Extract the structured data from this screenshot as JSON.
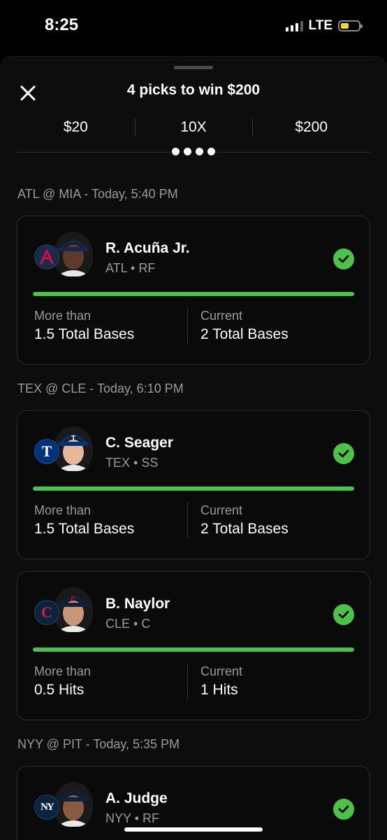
{
  "status_bar": {
    "time": "8:25",
    "network": "LTE"
  },
  "sheet": {
    "title": "4 picks to win $200",
    "summary": {
      "entry": "$20",
      "multiplier": "10X",
      "payout": "$200"
    }
  },
  "picks": [
    {
      "game_label": "ATL @ MIA - Today, 5:40 PM",
      "team_logo_letter": "A",
      "team_color": "#13274F",
      "accent_color": "#CE1141",
      "player_name": "R. Acuña Jr.",
      "team": "ATL",
      "position": "RF",
      "stat_label": "More than",
      "stat_line": "1.5 Total Bases",
      "current_label": "Current",
      "current_value": "2 Total Bases",
      "progress": 1.0,
      "status_icon": "check-icon"
    },
    {
      "game_label": "TEX @ CLE - Today, 6:10 PM",
      "team_logo_letter": "T",
      "team_color": "#003278",
      "accent_color": "#C0111F",
      "player_name": "C. Seager",
      "team": "TEX",
      "position": "SS",
      "stat_label": "More than",
      "stat_line": "1.5 Total Bases",
      "current_label": "Current",
      "current_value": "2 Total Bases",
      "progress": 1.0,
      "status_icon": "check-icon"
    },
    {
      "game_label": "",
      "team_logo_letter": "C",
      "team_color": "#0C2340",
      "accent_color": "#E31937",
      "player_name": "B. Naylor",
      "team": "CLE",
      "position": "C",
      "stat_label": "More than",
      "stat_line": "0.5 Hits",
      "current_label": "Current",
      "current_value": "1 Hits",
      "progress": 1.0,
      "status_icon": "check-icon"
    },
    {
      "game_label": "NYY @ PIT - Today, 5:35 PM",
      "team_logo_letter": "NY",
      "team_color": "#0C2340",
      "accent_color": "#C4CED3",
      "player_name": "A. Judge",
      "team": "NYY",
      "position": "RF",
      "status_icon": "check-icon"
    }
  ],
  "meta_separator": "•",
  "colors": {
    "success": "#4CC24A",
    "background": "#0D0D0D",
    "muted_text": "#9A9A9A"
  }
}
